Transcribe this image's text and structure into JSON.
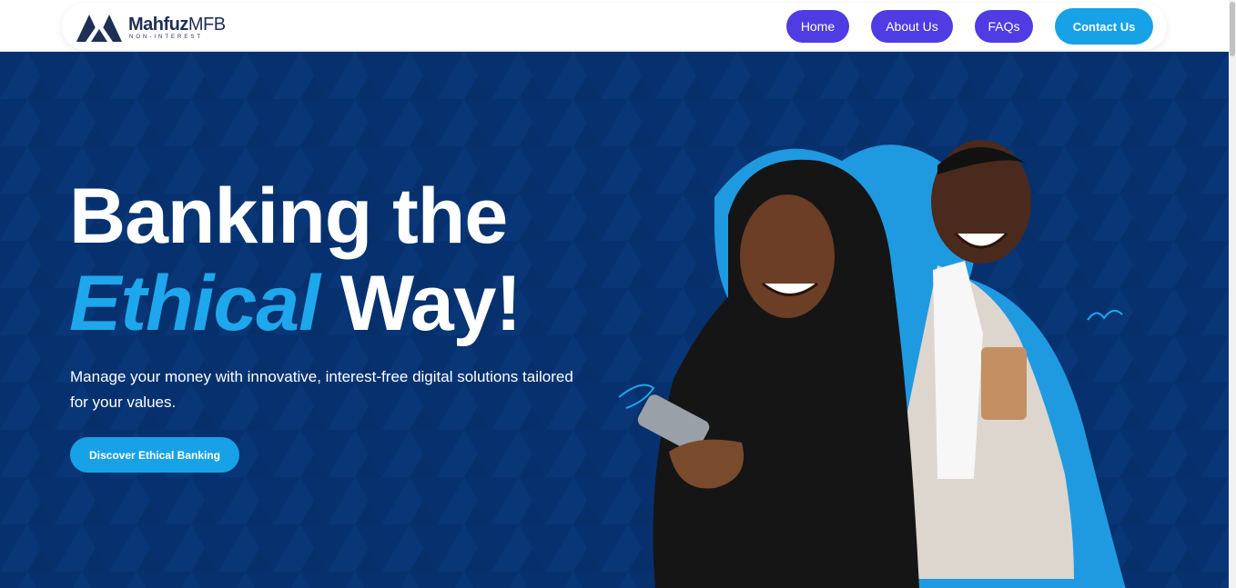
{
  "brand": {
    "name_bold": "Mahfuz",
    "name_light": "MFB",
    "tagline": "NON-INTEREST"
  },
  "nav": {
    "home": "Home",
    "about": "About Us",
    "faqs": "FAQs",
    "contact": "Contact Us"
  },
  "hero": {
    "headline_line1": "Banking the",
    "headline_accent": "Ethical",
    "headline_rest": " Way!",
    "subtext": "Manage your money with innovative, interest-free digital solutions tailored for your values.",
    "cta_label": "Discover Ethical Banking"
  },
  "colors": {
    "navy": "#06316e",
    "accent_blue": "#1ea7ec",
    "nav_purple": "#4f3ce2",
    "cta_blue": "#17a2e8"
  }
}
